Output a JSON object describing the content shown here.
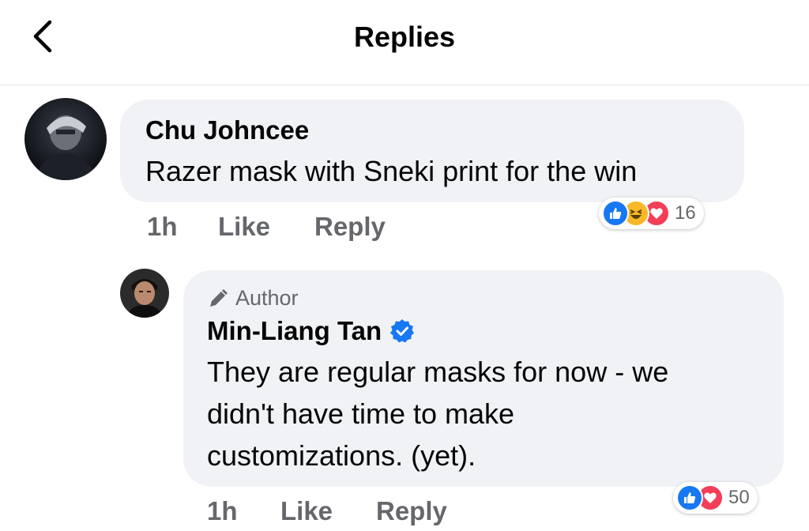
{
  "header": {
    "title": "Replies",
    "back_icon": "chevron-left-icon"
  },
  "comment": {
    "author": "Chu Johncee",
    "text": "Razer mask with Sneki print for the win",
    "time": "1h",
    "like_label": "Like",
    "reply_label": "Reply",
    "reactions": {
      "icons": [
        "like-icon",
        "haha-icon",
        "love-icon"
      ],
      "count": "16"
    }
  },
  "reply": {
    "badge": "Author",
    "badge_icon": "pencil-icon",
    "author": "Min-Liang Tan",
    "verified_icon": "verified-badge-icon",
    "text_lines": [
      "They are regular masks for now - we",
      "didn't have time to make",
      "customizations. (yet)."
    ],
    "time": "1h",
    "like_label": "Like",
    "reply_label": "Reply",
    "reactions": {
      "icons": [
        "like-icon",
        "love-icon"
      ],
      "count": "50"
    }
  },
  "colors": {
    "like": "#1877f2",
    "love": "#f33e58",
    "haha": "#f7b928",
    "bubble": "#f0f2f5",
    "verified": "#1877f2",
    "meta_text": "#65676b"
  }
}
